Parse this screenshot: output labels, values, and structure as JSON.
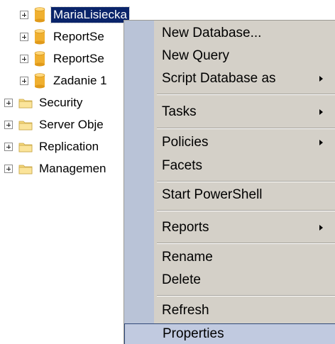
{
  "tree": {
    "databases": [
      {
        "label": "MariaLisiecka",
        "selected": true
      },
      {
        "label": "ReportSe"
      },
      {
        "label": "ReportSe"
      },
      {
        "label": "Zadanie 1"
      }
    ],
    "folders": [
      {
        "label": "Security"
      },
      {
        "label": "Server Obje"
      },
      {
        "label": "Replication"
      },
      {
        "label": "Managemen"
      }
    ]
  },
  "context_menu": {
    "items": [
      {
        "label": "New Database...",
        "has_submenu": false
      },
      {
        "label": "New Query",
        "has_submenu": false
      },
      {
        "label": "Script Database as",
        "has_submenu": true
      },
      {
        "label": "Tasks",
        "has_submenu": true
      },
      {
        "label": "Policies",
        "has_submenu": true
      },
      {
        "label": "Facets",
        "has_submenu": false
      },
      {
        "label": "Start PowerShell",
        "has_submenu": false
      },
      {
        "label": "Reports",
        "has_submenu": true
      },
      {
        "label": "Rename",
        "has_submenu": false
      },
      {
        "label": "Delete",
        "has_submenu": false
      },
      {
        "label": "Refresh",
        "has_submenu": false
      },
      {
        "label": "Properties",
        "has_submenu": false,
        "highlighted": true
      }
    ]
  },
  "colors": {
    "selection": "#0a246a",
    "menu_background": "#d4d0c8",
    "menu_gutter": "#b9c3d7",
    "menu_highlight": "#c1cae0",
    "folder": "#f5d77a",
    "database": "#f0b030"
  }
}
